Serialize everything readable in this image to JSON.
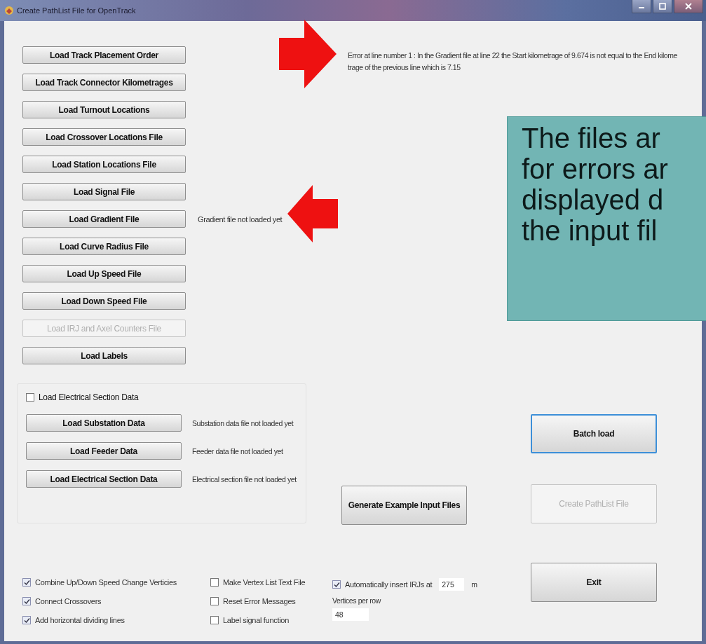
{
  "window": {
    "title": "Create PathList File for OpenTrack"
  },
  "load_buttons": [
    {
      "label": "Load Track Placement Order",
      "disabled": false
    },
    {
      "label": "Load Track Connector Kilometrages",
      "disabled": false
    },
    {
      "label": "Load Turnout Locations",
      "disabled": false
    },
    {
      "label": "Load Crossover Locations File",
      "disabled": false
    },
    {
      "label": "Load Station Locations File",
      "disabled": false
    },
    {
      "label": "Load Signal File",
      "disabled": false
    },
    {
      "label": "Load Gradient File",
      "disabled": false,
      "status": "Gradient file not loaded yet"
    },
    {
      "label": "Load Curve Radius File",
      "disabled": false
    },
    {
      "label": "Load Up Speed File",
      "disabled": false
    },
    {
      "label": "Load Down Speed File",
      "disabled": false
    },
    {
      "label": "Load IRJ and Axel Counters File",
      "disabled": true
    },
    {
      "label": "Load Labels",
      "disabled": false
    }
  ],
  "error_message": {
    "lines": [
      "Error at line number 1 :     In the Gradient file at line 22 the Start kilometrage of 9.674 is not equal to the End kilome",
      "trage of the previous line which is 7.15"
    ]
  },
  "electrical_group": {
    "checkbox": {
      "label": "Load Electrical Section Data",
      "checked": false
    },
    "buttons": [
      {
        "label": "Load Substation Data",
        "status": "Substation data file not loaded yet"
      },
      {
        "label": "Load Feeder Data",
        "status": "Feeder data file not loaded yet"
      },
      {
        "label": "Load Electrical Section Data",
        "status": "Electrical section file not loaded yet"
      }
    ]
  },
  "generate_button": {
    "label": "Generate Example Input Files",
    "disabled": false
  },
  "action_buttons": [
    {
      "label": "Batch load",
      "disabled": false,
      "focused": true
    },
    {
      "label": "Create PathList File",
      "disabled": true,
      "focused": false
    },
    {
      "label": "Exit",
      "disabled": false,
      "focused": false
    }
  ],
  "options": [
    [
      {
        "label": "Combine Up/Down Speed Change Verticies",
        "checked": true
      },
      {
        "label": "Connect Crossovers",
        "checked": true
      },
      {
        "label": "Add horizontal dividing lines",
        "checked": true
      }
    ],
    [
      {
        "label": "Make Vertex List Text File",
        "checked": false
      },
      {
        "label": "Reset Error Messages",
        "checked": false
      },
      {
        "label": "Label signal function",
        "checked": false
      }
    ]
  ],
  "irj_option": {
    "label": "Automatically insert IRJs at",
    "checked": true,
    "value": "275",
    "unit": "m"
  },
  "vertices_per_row": {
    "label": "Vertices per row",
    "value": "48"
  },
  "callout": {
    "lines": [
      "The files ar",
      "for errors ar",
      "displayed d",
      "the input fil"
    ]
  },
  "annotations": [
    {
      "kind": "rightarrow"
    },
    {
      "kind": "leftarrow"
    }
  ]
}
